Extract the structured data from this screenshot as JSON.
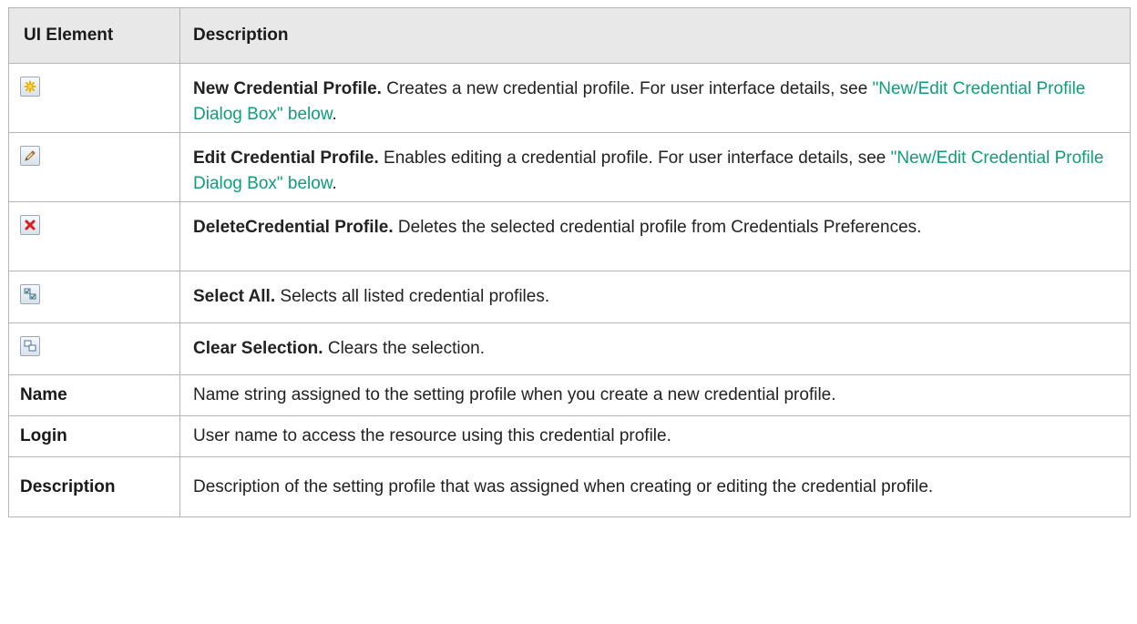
{
  "header": {
    "col1": "UI Element",
    "col2": "Description"
  },
  "rows": [
    {
      "icon": "new-star-icon",
      "title": "New Credential Profile.",
      "text": " Creates a new credential profile. For user interface details, see ",
      "link": "\"New/Edit Credential Profile Dialog Box\" below",
      "tail": "."
    },
    {
      "icon": "edit-pencil-icon",
      "title": "Edit Credential Profile.",
      "text": " Enables editing a credential profile. For user interface details, see ",
      "link": "\"New/Edit Credential Profile Dialog Box\" below",
      "tail": "."
    },
    {
      "icon": "delete-x-icon",
      "title": "DeleteCredential Profile.",
      "text": " Deletes the selected credential profile from Credentials Preferences."
    },
    {
      "icon": "select-all-icon",
      "title": "Select All.",
      "text": " Selects all listed credential profiles."
    },
    {
      "icon": "clear-selection-icon",
      "title": "Clear Selection.",
      "text": " Clears the selection."
    },
    {
      "element": "Name",
      "text": "Name string assigned to the setting profile when you create a new credential profile."
    },
    {
      "element": "Login",
      "text": "User name to access the resource using this credential profile."
    },
    {
      "element": "Description",
      "text": "Description of the setting profile that was assigned when creating or editing the credential profile."
    }
  ],
  "colors": {
    "header_bg": "#e8e8e8",
    "link": "#0d9e7a",
    "border": "#b5b5b5"
  }
}
